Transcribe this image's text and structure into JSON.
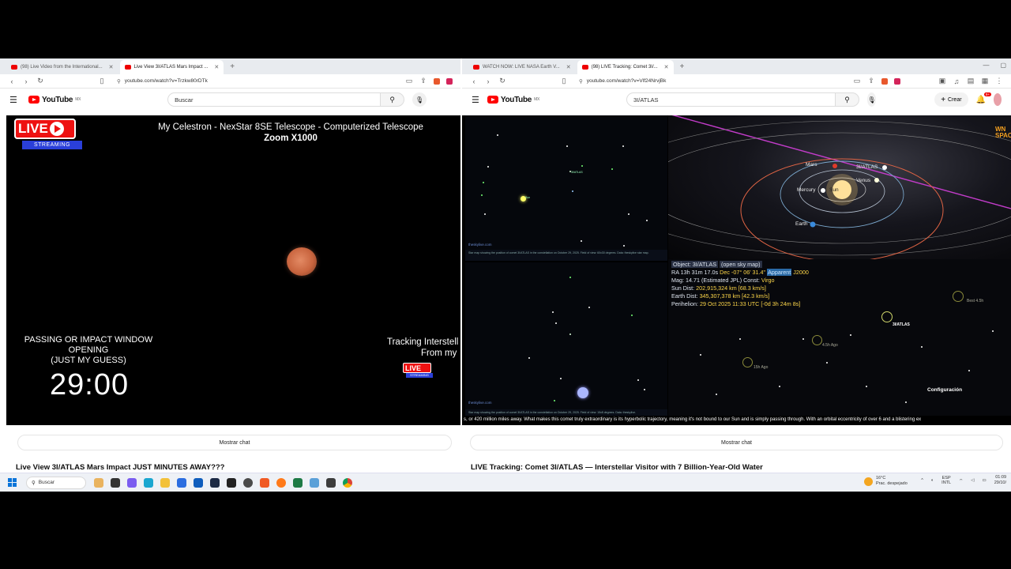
{
  "left_window": {
    "tabs": [
      {
        "title": "(98) Live Video from the International..."
      },
      {
        "title": "Live View 3I/ATLAS Mars Impact ..."
      }
    ],
    "url": "youtube.com/watch?v=Trzkw80rDTk",
    "search_placeholder": "Buscar",
    "logo_region": "MX",
    "overlay": {
      "live": "LIVE",
      "streaming": "STREAMING",
      "title_line1": "My Celestron - NexStar 8SE Telescope - Computerized Telescope",
      "title_line2": "Zoom X1000",
      "pass_line1": "PASSING OR IMPACT WINDOW",
      "pass_line2": "OPENING",
      "pass_line3": "(JUST MY GUESS)",
      "timer": "29:00",
      "tracking_line1": "Tracking Interstell",
      "tracking_line2": "From my"
    },
    "chat_button": "Mostrar chat",
    "video_title": "Live View 3I/ATLAS Mars Impact JUST MINUTES AWAY???"
  },
  "right_window": {
    "tabs": [
      {
        "title": "WATCH NOW: LIVE NASA Earth V..."
      },
      {
        "title": "(98) LIVE Tracking: Comet 3I/..."
      }
    ],
    "url": "youtube.com/watch?v=Vlf24NrvjBk",
    "search_value": "3I/ATLAS",
    "create_label": "Crear",
    "notif_count": "9+",
    "logo_region": "MX",
    "starmap_site_top": "theskylive.com",
    "starmap_site_bottom": "theskylive.com",
    "starmap_caption_top": "Star map showing the position of comet 3I/ATLAS in the constellation on October 29, 2025. Field of view: 60x30 degrees. Data: theskylive star map.",
    "starmap_caption_bottom": "Star map showing the position of comet 3I/ATLAS in the constellation on October 29, 2025. Field of view: 15x8 degrees. Data: theskylive.",
    "solar_labels": {
      "mars": "Mars",
      "atlas": "3I/ATLAS",
      "venus": "Venus",
      "mercury": "Mercury",
      "sun": "Sun",
      "earth": "Earth",
      "brand": "WN SPACE"
    },
    "object_panel": {
      "object": "Object: 3I/ATLAS",
      "open_map": "(open sky map)",
      "ra_prefix": "RA",
      "ra": "13h 31m 17.0s",
      "dec": "Dec -07° 06' 31.4\"",
      "epoch_badge": "Apparent",
      "epoch": "J2000",
      "mag": "Mag: 14.71",
      "mag_note": "(Estimated JPL)",
      "const_label": "Const:",
      "const": "Virgo",
      "sun_dist_label": "Sun Dist:",
      "sun_dist": "202,915,324 km [68.3 km/s]",
      "earth_dist_label": "Earth Dist:",
      "earth_dist": "345,307,378 km [42.3 km/s]",
      "perihelion_label": "Perihelion:",
      "perihelion": "29 Oct 2025 11:33 UTC [-0d 3h 24m 8s]"
    },
    "sky_labels": {
      "atlas": "3I/ATLAS",
      "best": "Best 4.5h",
      "ago1": "4.5h Ago",
      "ago2": "15h Ago",
      "config": "Configuración"
    },
    "ticker": "s, or 420 million miles away. What makes this comet truly extraordinary is its hyperbolic trajectory, meaning it's not bound to our Sun and is simply passing through. With an orbital eccentricity of over 6 and a blistering ex",
    "chat_button": "Mostrar chat",
    "video_title": "LIVE Tracking: Comet 3I/ATLAS — Interstellar Visitor with 7 Billion-Year-Old Water"
  },
  "taskbar": {
    "search": "Buscar",
    "weather_temp": "16°C",
    "weather_desc": "Prac. despejado",
    "lang1": "ESP",
    "lang2": "INTL",
    "time": "01:09",
    "date": "29/10/"
  }
}
